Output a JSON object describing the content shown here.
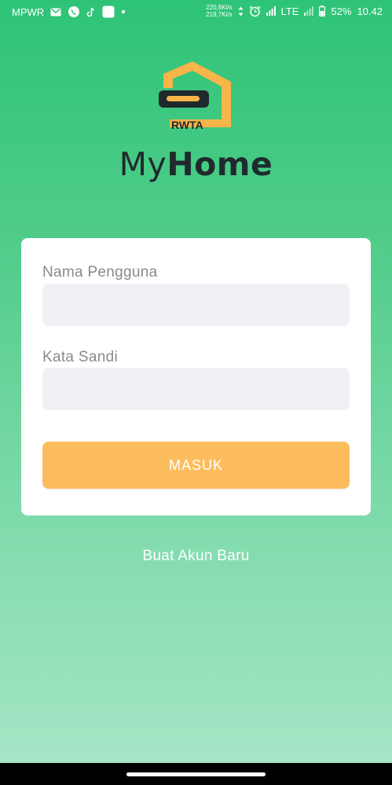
{
  "status_bar": {
    "carrier": "MPWR",
    "net_up": "220,8Ki/s",
    "net_down": "219,7Ki/s",
    "network": "LTE",
    "battery": "52%",
    "time": "10.42",
    "icons": [
      "gmail-icon",
      "whatsapp-icon",
      "tiktok-icon",
      "app-icon",
      "dot-icon",
      "data-arrows-icon",
      "alarm-icon",
      "signal-icon",
      "signal-icon-2",
      "battery-icon"
    ]
  },
  "logo": {
    "badge_text": "RWTA",
    "colors": {
      "orange": "#f9b44a",
      "dark": "#1f2a2e"
    }
  },
  "brand": {
    "light": "My",
    "bold": "Home"
  },
  "form": {
    "username_label": "Nama Pengguna",
    "username_value": "",
    "password_label": "Kata Sandi",
    "password_value": "",
    "submit_label": "MASUK"
  },
  "signup_label": "Buat Akun Baru",
  "colors": {
    "accent": "#fdbd5d",
    "input_bg": "#f0f1f4",
    "gradient_top": "#2ec477",
    "gradient_bottom": "#a8e6c8"
  }
}
